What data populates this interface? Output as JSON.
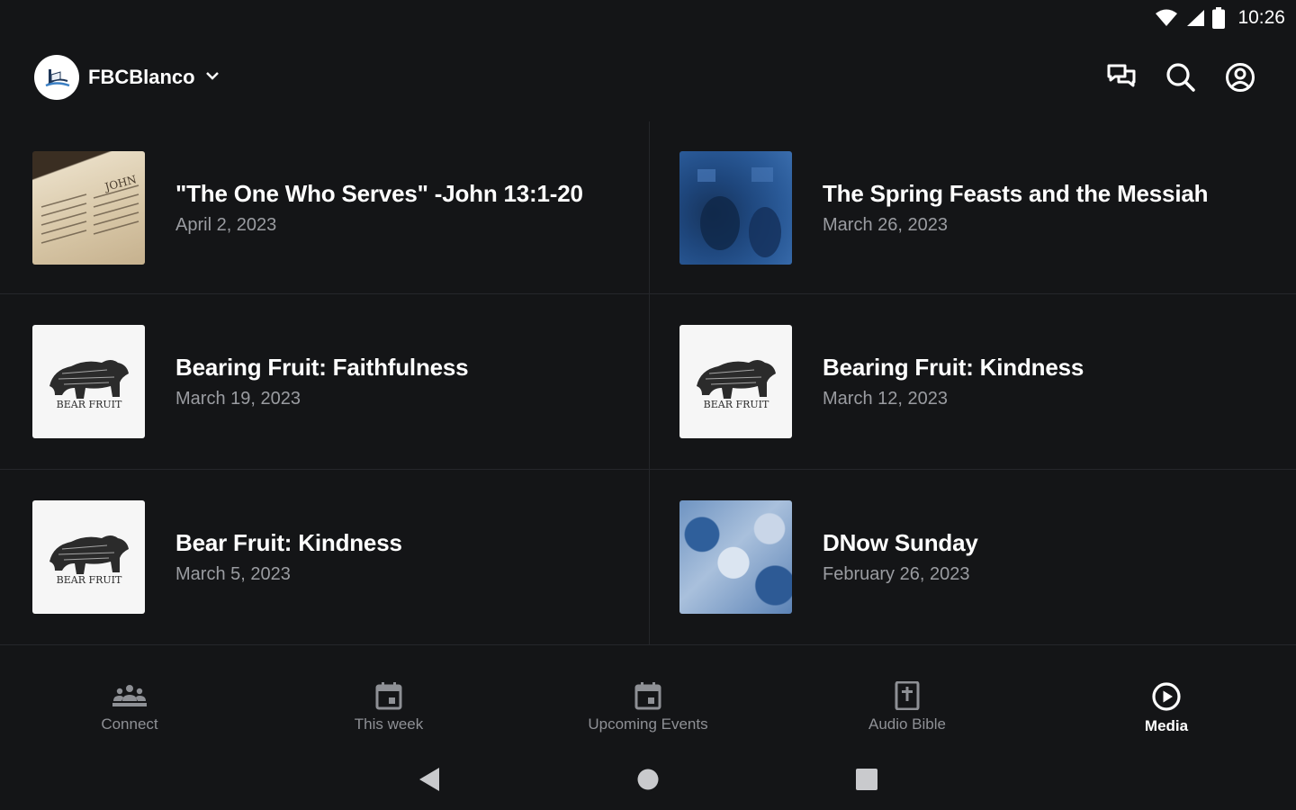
{
  "status_bar": {
    "time": "10:26",
    "icons": [
      "wifi-icon",
      "cell-signal-icon",
      "battery-icon"
    ]
  },
  "header": {
    "org_name": "FBCBlanco",
    "org_logo": "church-logo",
    "dropdown_icon": "chevron-down-icon",
    "actions": [
      "chat-icon",
      "search-icon",
      "account-icon"
    ]
  },
  "media": {
    "items": [
      {
        "title": "\"The One Who Serves\" -John 13:1-20",
        "date": "April 2, 2023",
        "thumbnail": "bible-page"
      },
      {
        "title": "The Spring Feasts and the Messiah",
        "date": "March 26, 2023",
        "thumbnail": "church-service-photo"
      },
      {
        "title": "Bearing Fruit: Faithfulness",
        "date": "March 19, 2023",
        "thumbnail": "bear-fruit-logo"
      },
      {
        "title": "Bearing Fruit: Kindness",
        "date": "March 12, 2023",
        "thumbnail": "bear-fruit-logo"
      },
      {
        "title": "Bear Fruit: Kindness",
        "date": "March 5, 2023",
        "thumbnail": "bear-fruit-logo"
      },
      {
        "title": "DNow Sunday",
        "date": "February 26, 2023",
        "thumbnail": "youth-crowd-photo"
      }
    ]
  },
  "bottom_nav": {
    "items": [
      {
        "label": "Connect",
        "icon": "people-icon",
        "active": false
      },
      {
        "label": "This week",
        "icon": "calendar-icon",
        "active": false
      },
      {
        "label": "Upcoming Events",
        "icon": "calendar-event-icon",
        "active": false
      },
      {
        "label": "Audio Bible",
        "icon": "bible-icon",
        "active": false
      },
      {
        "label": "Media",
        "icon": "play-circle-icon",
        "active": true
      }
    ]
  },
  "system_nav": [
    "back-icon",
    "home-icon",
    "recents-icon"
  ],
  "colors": {
    "background": "#141517",
    "text_primary": "#ffffff",
    "text_secondary": "#9a9ca1",
    "nav_inactive": "#8e9095"
  }
}
